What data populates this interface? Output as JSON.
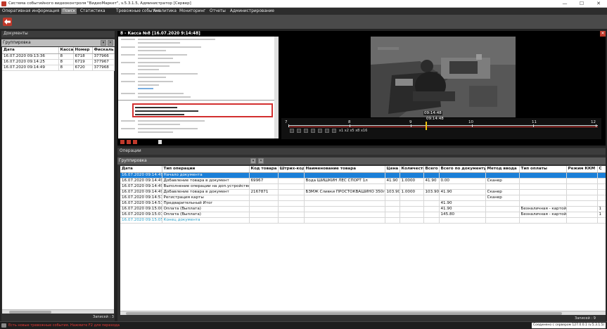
{
  "app": {
    "title": "Система событийного видеоконтроля \"ВидеоМаркет\", v.5.3.1.5, Администратор  [Сервер]"
  },
  "window_controls": {
    "minimize": "—",
    "maximize": "☐",
    "close": "✕"
  },
  "menu": {
    "items": [
      "Оперативная информация",
      "Поиск",
      "Статистика",
      "Тревожные события",
      "Аналитика",
      "Мониторинг",
      "Отчеты",
      "Администрирование"
    ],
    "active": "Поиск"
  },
  "documents": {
    "header": "Документы",
    "grouping_label": "Группировка",
    "columns": [
      "Дата",
      "Касса",
      "Номер",
      "Фискаль"
    ],
    "rows": [
      [
        "16.07.2020 09:13:36",
        "8",
        "6718",
        "377966"
      ],
      [
        "16.07.2020 09:14:25",
        "8",
        "6719",
        "377967"
      ],
      [
        "16.07.2020 09:14:49",
        "8",
        "6720",
        "377968"
      ]
    ],
    "records": "Записей : 3"
  },
  "video": {
    "title": "8 - Касса №8   [16.07.2020 9:14:48]",
    "time_overlay": "09:14:48",
    "timeline_labels": [
      "7",
      "8",
      "9",
      "10",
      "11",
      "12"
    ],
    "timeline_cursor": "09:14:48",
    "speed_labels": [
      "х1",
      "х2",
      "х5",
      "х8",
      "х16"
    ]
  },
  "operations": {
    "header": "Операции",
    "grouping_label": "Группировка",
    "columns": [
      "Дата",
      "Тип операции",
      "Код товара",
      "Штрих-код",
      "Наименование товара",
      "Цена",
      "Количество",
      "Всего",
      "Всего по документу",
      "Метод ввода",
      "Тип оплаты",
      "Режим ККМ",
      "С"
    ],
    "rows": [
      [
        "16.07.2020 09:14:49",
        "Начало документа",
        "",
        "",
        "",
        "",
        "",
        "",
        "",
        "",
        "",
        "",
        ""
      ],
      [
        "16.07.2020 09:14:49",
        "Добавление товара в документ",
        "69967",
        "",
        "Вода ШИШКИН ЛЕС СПОРТ 1л",
        "41.90",
        "1.0000",
        "41.90",
        "0.00",
        "Сканер",
        "",
        "",
        ""
      ],
      [
        "16.07.2020 09:14:49",
        "Выполнение операции на доп.устройстве",
        "",
        "",
        "",
        "",
        "",
        "",
        "",
        "",
        "",
        "",
        ""
      ],
      [
        "16.07.2020 09:14:49",
        "Добавление товара в документ",
        "2167871",
        "",
        "БЗМЖ Сливки ПРОСТОКВАШИНО 350г",
        "103.90",
        "1.0000",
        "103.90",
        "41.90",
        "Сканер",
        "",
        "",
        ""
      ],
      [
        "16.07.2020 09:14:51",
        "Регистрация карты",
        "",
        "",
        "",
        "",
        "",
        "",
        "",
        "Сканер",
        "",
        "",
        ""
      ],
      [
        "16.07.2020 09:14:51",
        "Предварительный Итог",
        "",
        "",
        "",
        "",
        "",
        "",
        "41.90",
        "",
        "",
        "",
        ""
      ],
      [
        "16.07.2020 09:15:00",
        "Оплата (Выплата)",
        "",
        "",
        "",
        "",
        "",
        "",
        "41.90",
        "",
        "Безналичная - картой",
        "",
        "1"
      ],
      [
        "16.07.2020 09:15:01",
        "Оплата (Выплата)",
        "",
        "",
        "",
        "",
        "",
        "",
        "145.80",
        "",
        "Безналичная - картой",
        "",
        "1"
      ],
      [
        "16.07.2020 09:15:05",
        "Конец документа",
        "",
        "",
        "",
        "",
        "",
        "",
        "",
        "",
        "",
        "",
        ""
      ]
    ],
    "records": "Записей : 9"
  },
  "statusbar": {
    "alert": "Есть новые тревожные события. Нажмите F2 для перехода",
    "connection": "Соединено с сервером 127.0.0.1 (v.5.3.1.5)"
  },
  "colors": {
    "accent": "#1a7fd8",
    "alert_red": "#e53935",
    "brand_red": "#c0392b",
    "cyan_text": "#2aa0c8"
  }
}
